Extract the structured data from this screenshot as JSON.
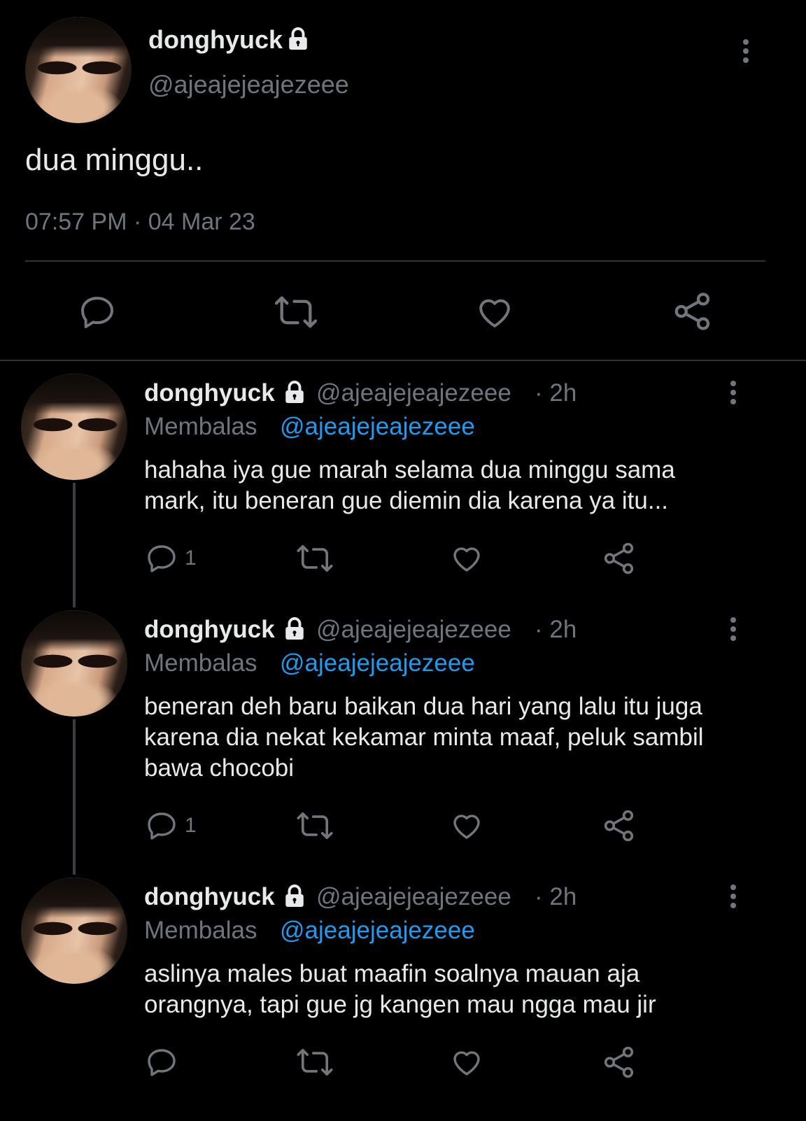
{
  "main_tweet": {
    "display_name": "donghyuck",
    "handle": "@ajeajejeajezeee",
    "text": "dua minggu..",
    "timestamp": "07:57 PM · 04 Mar 23",
    "actions": [
      "reply-icon",
      "retweet-icon",
      "like-icon",
      "share-icon"
    ]
  },
  "replies": [
    {
      "display_name": "donghyuck",
      "handle": "@ajeajejeajezeee",
      "time": "· 2h",
      "replying_label": "Membalas",
      "replying_to": "@ajeajejeajezeee",
      "text_line1": "hahaha iya gue marah selama dua minggu sama",
      "text_line2": "mark, itu beneran gue diemin dia karena ya itu...",
      "text_line3": "",
      "reply_count": "1"
    },
    {
      "display_name": "donghyuck",
      "handle": "@ajeajejeajezeee",
      "time": "· 2h",
      "replying_label": "Membalas",
      "replying_to": "@ajeajejeajezeee",
      "text_line1": "beneran deh baru baikan dua hari yang lalu itu juga",
      "text_line2": "karena dia nekat kekamar minta maaf, peluk sambil",
      "text_line3": "bawa chocobi",
      "reply_count": "1"
    },
    {
      "display_name": "donghyuck",
      "handle": "@ajeajejeajezeee",
      "time": "· 2h",
      "replying_label": "Membalas",
      "replying_to": "@ajeajejeajezeee",
      "text_line1": "aslinya males buat maafin soalnya mauan aja",
      "text_line2": "orangnya, tapi gue jg kangen mau ngga mau jir",
      "text_line3": "",
      "reply_count": ""
    }
  ],
  "colors": {
    "background": "#000000",
    "text": "#e7e9ea",
    "secondary": "#6e767d",
    "link": "#1d9bf0"
  }
}
